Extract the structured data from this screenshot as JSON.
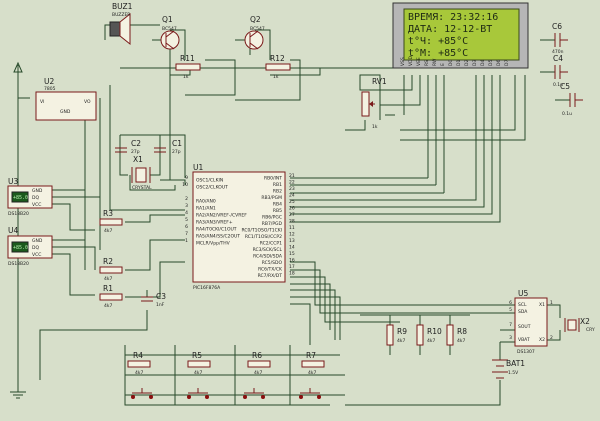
{
  "components": {
    "buzzer": {
      "ref": "BUZ1",
      "value": "BUZZER"
    },
    "q1": {
      "ref": "Q1",
      "value": "BC547"
    },
    "q2": {
      "ref": "Q2",
      "value": "BC547"
    },
    "r11": {
      "ref": "R11",
      "value": "1k"
    },
    "r12": {
      "ref": "R12",
      "value": "1k"
    },
    "u2": {
      "ref": "U2",
      "value": "7805",
      "pins": [
        "VI",
        "VO",
        "GND"
      ]
    },
    "rv1": {
      "ref": "RV1",
      "value": "1k"
    },
    "lcd": {
      "lines": [
        "ВРЕМЯ:  23:32:16",
        "ДАТА:  12-12-ВТ",
        "t°Ч:       +85°C",
        "t°М:       +85°C"
      ],
      "pins": [
        "VSS",
        "VDD",
        "VEE",
        "RS",
        "RW",
        "E",
        "D0",
        "D1",
        "D2",
        "D3",
        "D4",
        "D5",
        "D6",
        "D7"
      ]
    },
    "c6": {
      "ref": "C6",
      "value": "470n"
    },
    "c4": {
      "ref": "C4",
      "value": "0.1u"
    },
    "c5": {
      "ref": "C5",
      "value": "0.1u"
    },
    "c2": {
      "ref": "C2",
      "value": "27p"
    },
    "c1": {
      "ref": "C1",
      "value": "27p"
    },
    "x1": {
      "ref": "X1",
      "value": "CRYSTAL"
    },
    "u3": {
      "ref": "U3",
      "value": "DS18B20",
      "pins": [
        "GND",
        "DQ",
        "VCC"
      ]
    },
    "u4": {
      "ref": "U4",
      "value": "DS18B20",
      "pins": [
        "GND",
        "DQ",
        "VCC"
      ]
    },
    "r3": {
      "ref": "R3",
      "value": "4k7"
    },
    "r2": {
      "ref": "R2",
      "value": "4k7"
    },
    "r1": {
      "ref": "R1",
      "value": "4k7"
    },
    "c3": {
      "ref": "C3",
      "value": "1nF"
    },
    "u1": {
      "ref": "U1",
      "value": "PIC16F876A",
      "left_pins": [
        "OSC1/CLKIN",
        "OSC2/CLKOUT",
        "RA0/AN0",
        "RA1/AN1",
        "RA2/AN2/VREF-/CVREF",
        "RA3/AN3/VREF+",
        "RA4/T0CKI/C1OUT",
        "RA5/AN4/SS/C2OUT",
        "MCLR/Vpp/THV"
      ],
      "right_pins": [
        "RB0/INT",
        "RB1",
        "RB2",
        "RB3/PGM",
        "RB4",
        "RB5",
        "RB6/PGC",
        "RB7/PGD",
        "RC0/T1OSO/T1CKI",
        "RC1/T1OSI/CCP2",
        "RC2/CCP1",
        "RC3/SCK/SCL",
        "RC4/SDI/SDA",
        "RC5/SDO",
        "RC6/TX/CK",
        "RC7/RX/DT"
      ],
      "left_nums": [
        "9",
        "10",
        "2",
        "3",
        "4",
        "5",
        "6",
        "7",
        "1"
      ],
      "right_nums": [
        "21",
        "22",
        "23",
        "24",
        "25",
        "26",
        "27",
        "28",
        "11",
        "12",
        "13",
        "14",
        "15",
        "16",
        "17",
        "18"
      ]
    },
    "u5": {
      "ref": "U5",
      "value": "DS1307",
      "pins_left": [
        "SCL",
        "SDA",
        "SOUT",
        "VBAT"
      ],
      "pins_right": [
        "X1",
        "X2"
      ],
      "nums_left": [
        "6",
        "5",
        "7",
        "3"
      ],
      "nums_right": [
        "1",
        "2"
      ]
    },
    "x2": {
      "ref": "X2",
      "value": "CRY"
    },
    "r9": {
      "ref": "R9",
      "value": "4k7"
    },
    "r10": {
      "ref": "R10",
      "value": "4k7"
    },
    "r8": {
      "ref": "R8",
      "value": "4k7"
    },
    "bat1": {
      "ref": "BAT1",
      "value": "1.5V"
    },
    "r4": {
      "ref": "R4",
      "value": "4k7"
    },
    "r5": {
      "ref": "R5",
      "value": "4k7"
    },
    "r6": {
      "ref": "R6",
      "value": "4k7"
    },
    "r7": {
      "ref": "R7",
      "value": "4k7"
    }
  },
  "sensor_display": {
    "u3": "+85.0",
    "u4": "+85.0"
  },
  "colors": {
    "background": "#d7dfca",
    "wire": "#274a2a",
    "component": "#7a1a1a",
    "lcd_screen": "#a8c83a"
  }
}
